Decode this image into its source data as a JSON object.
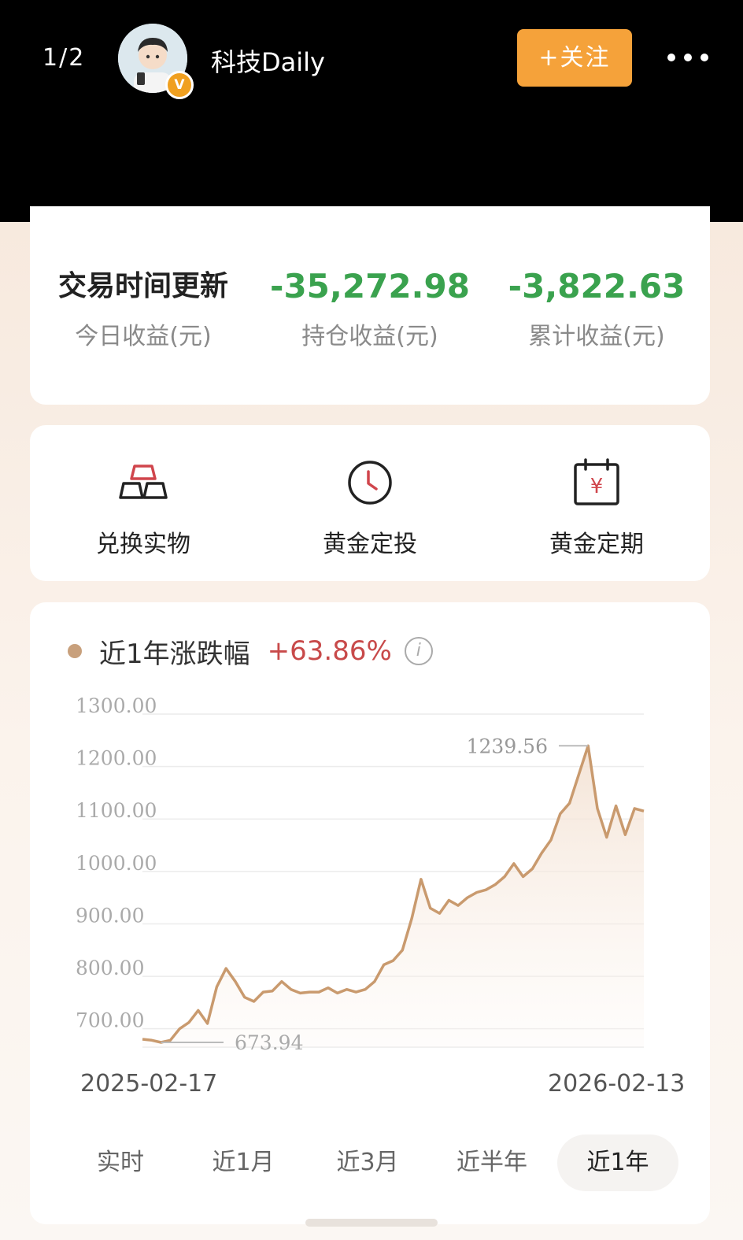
{
  "header": {
    "page_indicator": "1/2",
    "username": "科技Daily",
    "verified_badge": "V",
    "follow_label": "+关注"
  },
  "summary": {
    "today": {
      "value": "交易时间更新",
      "label": "今日收益(元)"
    },
    "holding": {
      "value": "-35,272.98",
      "label": "持仓收益(元)"
    },
    "cumulative": {
      "value": "-3,822.63",
      "label": "累计收益(元)"
    },
    "colors": {
      "negative": "#3aa24e",
      "positive": "#c84a4a"
    }
  },
  "actions": [
    {
      "label": "兑换实物",
      "icon": "gold-bars-icon"
    },
    {
      "label": "黄金定投",
      "icon": "clock-icon"
    },
    {
      "label": "黄金定期",
      "icon": "calendar-yen-icon",
      "icon_text": "¥"
    }
  ],
  "chart": {
    "title": "近1年涨跌幅",
    "change": "+63.86%",
    "info_icon": "i",
    "start_date": "2025-02-17",
    "end_date": "2026-02-13",
    "line_color": "#c99a6e"
  },
  "chart_data": {
    "type": "area",
    "x": [
      "2025-02-17",
      "2025-02-24",
      "2025-03-03",
      "2025-03-10",
      "2025-03-17",
      "2025-03-24",
      "2025-03-31",
      "2025-04-07",
      "2025-04-14",
      "2025-04-21",
      "2025-04-28",
      "2025-05-05",
      "2025-05-12",
      "2025-05-19",
      "2025-05-26",
      "2025-06-02",
      "2025-06-09",
      "2025-06-16",
      "2025-06-23",
      "2025-06-30",
      "2025-07-07",
      "2025-07-14",
      "2025-07-21",
      "2025-07-28",
      "2025-08-04",
      "2025-08-11",
      "2025-08-18",
      "2025-08-25",
      "2025-09-01",
      "2025-09-08",
      "2025-09-15",
      "2025-09-22",
      "2025-09-29",
      "2025-10-06",
      "2025-10-13",
      "2025-10-20",
      "2025-10-27",
      "2025-11-03",
      "2025-11-10",
      "2025-11-17",
      "2025-11-24",
      "2025-12-01",
      "2025-12-08",
      "2025-12-15",
      "2025-12-22",
      "2025-12-29",
      "2026-01-05",
      "2026-01-12",
      "2026-01-19",
      "2026-01-26",
      "2026-01-30",
      "2026-02-02",
      "2026-02-05",
      "2026-02-09",
      "2026-02-13"
    ],
    "values": [
      680,
      678,
      674,
      678,
      700,
      712,
      735,
      710,
      780,
      815,
      790,
      760,
      752,
      770,
      772,
      790,
      775,
      768,
      770,
      770,
      778,
      768,
      775,
      770,
      775,
      790,
      822,
      830,
      850,
      910,
      985,
      930,
      920,
      945,
      935,
      950,
      960,
      965,
      975,
      990,
      1015,
      990,
      1005,
      1035,
      1060,
      1110,
      1130,
      1185,
      1239.56,
      1120,
      1065,
      1125,
      1070,
      1120,
      1115
    ],
    "annotations": {
      "max": "1239.56",
      "min": "673.94"
    },
    "y_ticks": [
      "1300.00",
      "1200.00",
      "1100.00",
      "1000.00",
      "900.00",
      "800.00",
      "700.00"
    ],
    "ylim": [
      665,
      1300
    ],
    "grid": true
  },
  "tabs": [
    {
      "label": "实时",
      "active": false
    },
    {
      "label": "近1月",
      "active": false
    },
    {
      "label": "近3月",
      "active": false
    },
    {
      "label": "近半年",
      "active": false
    },
    {
      "label": "近1年",
      "active": true
    }
  ]
}
